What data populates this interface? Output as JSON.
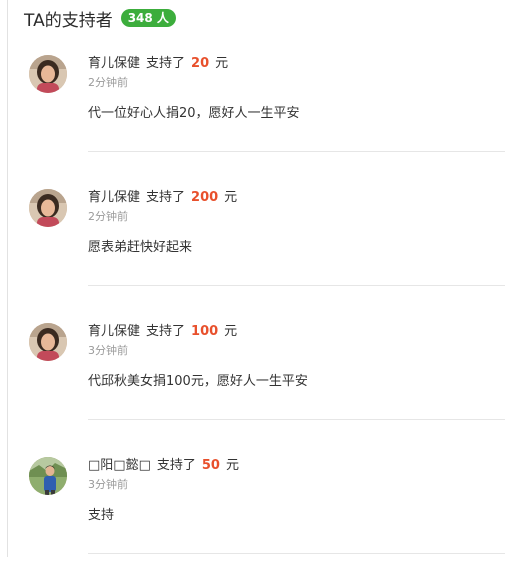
{
  "header": {
    "title": "TA的支持者",
    "count_badge": "348 人"
  },
  "supporters": [
    {
      "name": "育儿保健",
      "verb": "支持了",
      "amount": "20",
      "unit": "元",
      "time": "2分钟前",
      "message": "代一位好心人捐20，愿好人一生平安",
      "avatar": "woman-avatar"
    },
    {
      "name": "育儿保健",
      "verb": "支持了",
      "amount": "200",
      "unit": "元",
      "time": "2分钟前",
      "message": "愿表弟赶快好起来",
      "avatar": "woman-avatar"
    },
    {
      "name": "育儿保健",
      "verb": "支持了",
      "amount": "100",
      "unit": "元",
      "time": "3分钟前",
      "message": "代邱秋美女捐100元，愿好人一生平安",
      "avatar": "woman-avatar"
    },
    {
      "name": "□阳□懿□",
      "verb": "支持了",
      "amount": "50",
      "unit": "元",
      "time": "3分钟前",
      "message": "支持",
      "avatar": "person-outdoor-avatar"
    }
  ],
  "colors": {
    "badge": "#3cad3c",
    "amount": "#e8502c",
    "time": "#9a9a9a"
  }
}
